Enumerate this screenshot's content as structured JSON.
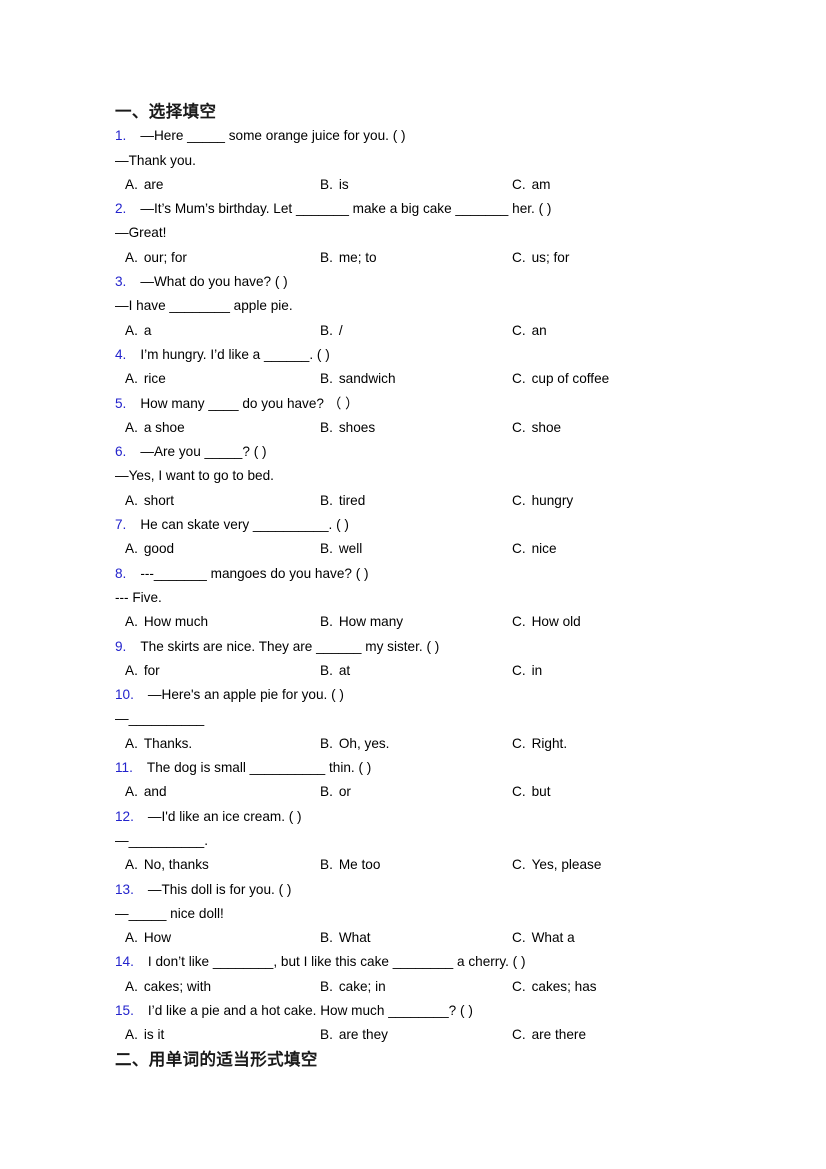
{
  "doc": {
    "heading_1": "一、选择填空",
    "heading_2": "二、用单词的适当形式填空"
  },
  "questions": [
    {
      "num": "1.",
      "stem": "—Here _____ some orange juice for you. (  )",
      "cont": "—Thank you.",
      "a": "A.",
      "a_text": "are",
      "b": "B.",
      "b_text": "is",
      "c": "C.",
      "c_text": "am"
    },
    {
      "num": "2.",
      "stem": "—It’s Mum’s birthday. Let _______ make a big cake _______ her. (   )",
      "cont": "—Great!",
      "a": "A.",
      "a_text": "our; for",
      "b": "B.",
      "b_text": "me; to",
      "c": "C.",
      "c_text": "us; for"
    },
    {
      "num": "3.",
      "stem": "—What do you have? (  )",
      "cont": "—I have ________ apple pie.",
      "a": "A.",
      "a_text": "a",
      "b": "B.",
      "b_text": "/",
      "c": "C.",
      "c_text": "an"
    },
    {
      "num": "4.",
      "stem": "I’m hungry. I’d like a ______. (  )",
      "cont": "",
      "a": "A.",
      "a_text": "rice",
      "b": "B.",
      "b_text": "sandwich",
      "c": "C.",
      "c_text": "cup of coffee"
    },
    {
      "num": "5.",
      "stem": "How many ____ do you have? （ ）",
      "cont": "",
      "a": "A.",
      "a_text": "a shoe",
      "b": "B.",
      "b_text": "shoes",
      "c": "C.",
      "c_text": "shoe"
    },
    {
      "num": "6.",
      "stem": "—Are you _____? (  )",
      "cont": "—Yes, I want to go to bed.",
      "a": "A.",
      "a_text": "short",
      "b": "B.",
      "b_text": "tired",
      "c": "C.",
      "c_text": "hungry"
    },
    {
      "num": "7.",
      "stem": "He can skate very __________. (    )",
      "cont": "",
      "a": "A.",
      "a_text": "good",
      "b": "B.",
      "b_text": "well",
      "c": "C.",
      "c_text": "nice"
    },
    {
      "num": "8.",
      "stem": "---_______ mangoes do you have? (   )",
      "cont": "--- Five.",
      "a": "A.",
      "a_text": "How much",
      "b": "B.",
      "b_text": "How many",
      "c": "C.",
      "c_text": "How old"
    },
    {
      "num": "9.",
      "stem": "The skirts are nice. They are ______ my sister. (   )",
      "cont": "",
      "a": "A.",
      "a_text": "for",
      "b": "B.",
      "b_text": "at",
      "c": "C.",
      "c_text": "in"
    },
    {
      "num": "10.",
      "stem": "—Here's an apple pie for you. (   )",
      "cont": "—__________",
      "a": "A.",
      "a_text": "Thanks.",
      "b": "B.",
      "b_text": "Oh, yes.",
      "c": "C.",
      "c_text": "Right."
    },
    {
      "num": "11.",
      "stem": "The dog is small __________ thin. (   )",
      "cont": "",
      "a": "A.",
      "a_text": "and",
      "b": "B.",
      "b_text": "or",
      "c": "C.",
      "c_text": "but"
    },
    {
      "num": "12.",
      "stem": "—I'd like an ice cream. (   )",
      "cont": "—__________.",
      "a": "A.",
      "a_text": "No, thanks",
      "b": "B.",
      "b_text": "Me too",
      "c": "C.",
      "c_text": "Yes, please"
    },
    {
      "num": "13.",
      "stem": "—This doll is for you. (   )",
      "cont": "—_____ nice doll!",
      "a": "A.",
      "a_text": "How",
      "b": "B.",
      "b_text": "What",
      "c": "C.",
      "c_text": "What a"
    },
    {
      "num": "14.",
      "stem": "I don’t like ________, but I like this cake ________ a cherry. (  )",
      "cont": "",
      "a": "A.",
      "a_text": "cakes; with",
      "b": "B.",
      "b_text": "cake; in",
      "c": "C.",
      "c_text": "cakes; has"
    },
    {
      "num": "15.",
      "stem": "I’d like a pie and a hot cake. How much ________? (  )",
      "cont": "",
      "a": "A.",
      "a_text": "is it",
      "b": "B.",
      "b_text": "are they",
      "c": "C.",
      "c_text": "are there"
    }
  ]
}
